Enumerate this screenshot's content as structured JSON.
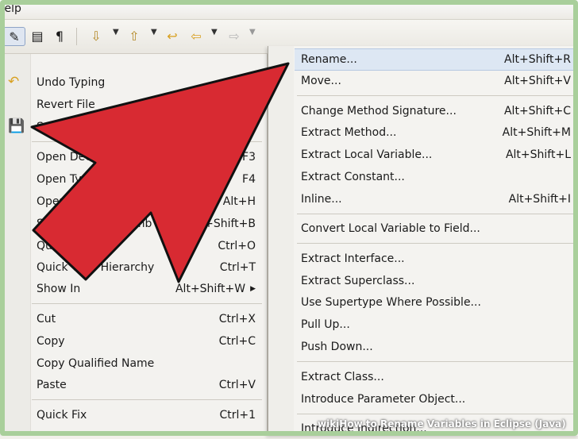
{
  "menubar": {
    "help": "Help"
  },
  "left_menu": {
    "items": [
      {
        "label": "Undo Typing",
        "accel": ""
      },
      {
        "label": "Revert File",
        "accel": ""
      },
      {
        "label": "Save",
        "accel": ""
      },
      {
        "label": "Open Declaration",
        "accel": "F3"
      },
      {
        "label": "Open Type",
        "accel": "F4"
      },
      {
        "label": "Open",
        "accel": "Alt+H"
      },
      {
        "label": "Show in Breadcrumb",
        "accel": "Alt+Shift+B"
      },
      {
        "label": "Quick Outline",
        "accel": "Ctrl+O"
      },
      {
        "label": "Quick Type Hierarchy",
        "accel": "Ctrl+T"
      },
      {
        "label": "Show In",
        "accel": "Alt+Shift+W"
      },
      {
        "label": "Cut",
        "accel": "Ctrl+X"
      },
      {
        "label": "Copy",
        "accel": "Ctrl+C"
      },
      {
        "label": "Copy Qualified Name",
        "accel": ""
      },
      {
        "label": "Paste",
        "accel": "Ctrl+V"
      },
      {
        "label": "Quick Fix",
        "accel": "Ctrl+1"
      }
    ]
  },
  "refactor_menu": {
    "items": [
      {
        "label": "Rename...",
        "accel": "Alt+Shift+R"
      },
      {
        "label": "Move...",
        "accel": "Alt+Shift+V"
      },
      {
        "label": "Change Method Signature...",
        "accel": "Alt+Shift+C"
      },
      {
        "label": "Extract Method...",
        "accel": "Alt+Shift+M"
      },
      {
        "label": "Extract Local Variable...",
        "accel": "Alt+Shift+L"
      },
      {
        "label": "Extract Constant...",
        "accel": ""
      },
      {
        "label": "Inline...",
        "accel": "Alt+Shift+I"
      },
      {
        "label": "Convert Local Variable to Field...",
        "accel": ""
      },
      {
        "label": "Extract Interface...",
        "accel": ""
      },
      {
        "label": "Extract Superclass...",
        "accel": ""
      },
      {
        "label": "Use Supertype Where Possible...",
        "accel": ""
      },
      {
        "label": "Pull Up...",
        "accel": ""
      },
      {
        "label": "Push Down...",
        "accel": ""
      },
      {
        "label": "Extract Class...",
        "accel": ""
      },
      {
        "label": "Introduce Parameter Object...",
        "accel": ""
      },
      {
        "label": "Introduce Indirection...",
        "accel": ""
      }
    ]
  },
  "watermark": {
    "text": "wikiHow to Rename Variables in Eclipse (Java)"
  },
  "colors": {
    "arrow_fill": "#d82a32",
    "arrow_stroke": "#111111",
    "highlight": "#dde7f3"
  }
}
